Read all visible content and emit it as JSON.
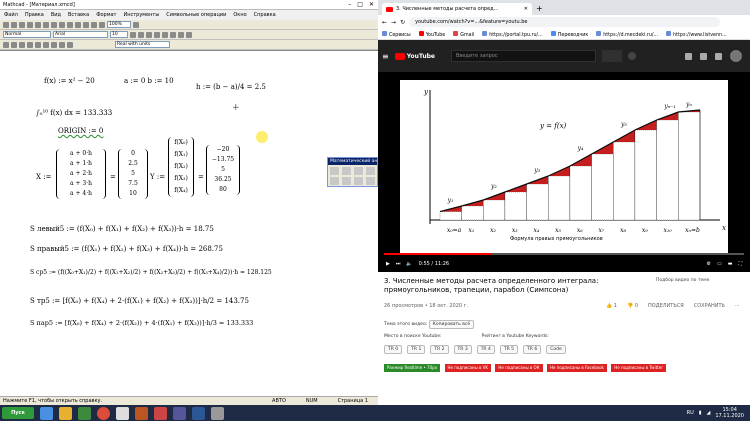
{
  "mathcad": {
    "title": "Mathcad - [Материал.xmcd]",
    "menu": [
      "Файл",
      "Правка",
      "Вид",
      "Вставка",
      "Формат",
      "Инструменты",
      "Символьные операции",
      "Окно",
      "Справка"
    ],
    "style_value": "Normal",
    "font_value": "Arial",
    "size_value": "10",
    "zoom_value": "100%",
    "units_value": "Real with units",
    "eq_f": "f(x) := x² − 20",
    "eq_ab": "a := 0   b := 10",
    "eq_h": "h := (b − a)/4 = 2.5",
    "eq_int": "∫₀¹⁰ f(x) dx = 133.333",
    "eq_origin": "ORIGIN := 0",
    "X_label": "X :=",
    "X_expr": [
      "a + 0·h",
      "a + 1·h",
      "a + 2·h",
      "a + 3·h",
      "a + 4·h"
    ],
    "X_vals": [
      "0",
      "2.5",
      "5",
      "7.5",
      "10"
    ],
    "Y_label": "Y :=",
    "Y_expr": [
      "f(X₀)",
      "f(X₁)",
      "f(X₂)",
      "f(X₃)",
      "f(X₄)"
    ],
    "Y_vals": [
      "−20",
      "−13.75",
      "5",
      "36.25",
      "80"
    ],
    "s_left": "S левый5 := (f(X₀) + f(X₁) + f(X₂) + f(X₃))·h = 18.75",
    "s_right": "S правый5 := (f(X₁) + f(X₂) + f(X₃) + f(X₄))·h = 268.75",
    "s_mid": "S ср5 := (f((X₀+X₁)/2) + f((X₁+X₂)/2) + f((X₂+X₃)/2) + f((X₃+X₄)/2))·h = 128.125",
    "s_trap": "S тр5 := [f(X₀) + f(X₄) + 2·(f(X₁) + f(X₂) + f(X₃))]·h/2 = 143.75",
    "s_simp": "S пар5 := [f(X₀) + f(X₄) + 2·(f(X₂)) + 4·(f(X₁) + f(X₃))]·h/3 = 133.333",
    "palette_title": "Математический анал",
    "status_help": "Нажмите F1, чтобы открыть справку.",
    "status_auto": "АВТО",
    "status_num": "NUM",
    "status_page": "Страница 1"
  },
  "chrome": {
    "tab_title": "3. Численные методы расчета опред...",
    "url": "youtube.com/watch?v=...&feature=youtu.be",
    "bookmarks": [
      "Сервисы",
      "YouTube",
      "Gmail",
      "https://portal.tpu.ru/...",
      "Переводчик",
      "https://d.mecdeki.ru/...",
      "https://www.listvenn..."
    ],
    "yt_brand": "YouTube",
    "search_placeholder": "Введите запрос",
    "video_caption": "y = f(x)",
    "video_formula_title": "Формула правых прямоугольников",
    "time": "0:55 / 11:26",
    "video_title": "3. Численные методы расчета определенного интеграла: прямоугольников, трапеции, парабол (Симпсона)",
    "views": "26 просмотров • 18 окт. 2020 г.",
    "likes": "1",
    "dislikes": "0",
    "share": "ПОДЕЛИТЬСЯ",
    "save": "СОХРАНИТЬ",
    "suggest_title": "Подбор видео по теме",
    "desc_label": "Тема этого видео:",
    "desc_chip": "Копировать всё",
    "desc_line2": "Место в поиске Youtube:",
    "desc_line3": "Рейтинг в Youtube Keywords:",
    "chips": [
      "TR 0",
      "TR 1",
      "TR 2",
      "TR 3",
      "TR 4",
      "TR 5",
      "TR 6",
      "Code"
    ],
    "btn_green": "Ранжир Realtime • 70px",
    "btn_red": [
      "Не подписаны в VK",
      "Не подписаны в ОК",
      "Не подписаны в Facebook",
      "Не подписаны в Twitter"
    ]
  },
  "taskbar": {
    "start": "Пуск",
    "lang": "RU",
    "time": "15:04",
    "date": "17.11.2020"
  },
  "chart_data": {
    "type": "bar",
    "title": "",
    "x": [
      "x₀=a",
      "x₁",
      "x₂",
      "x₃",
      "x₄",
      "x₅",
      "x₆",
      "x₇",
      "x₈",
      "x₉",
      "x₁₀",
      "xₙ=b"
    ],
    "values": [
      14,
      20,
      28,
      36,
      44,
      54,
      66,
      78,
      90,
      100,
      108,
      110
    ],
    "xlabel": "x",
    "ylabel": "y",
    "labels": [
      "y₁",
      "y₂",
      "y₃",
      "y₄",
      "y₅",
      "yₙ₋₁",
      "yₙ"
    ]
  },
  "colors": {
    "accent": "#ff0000",
    "bar_fill": "#c41e1e",
    "curve": "#0a0a0a"
  }
}
